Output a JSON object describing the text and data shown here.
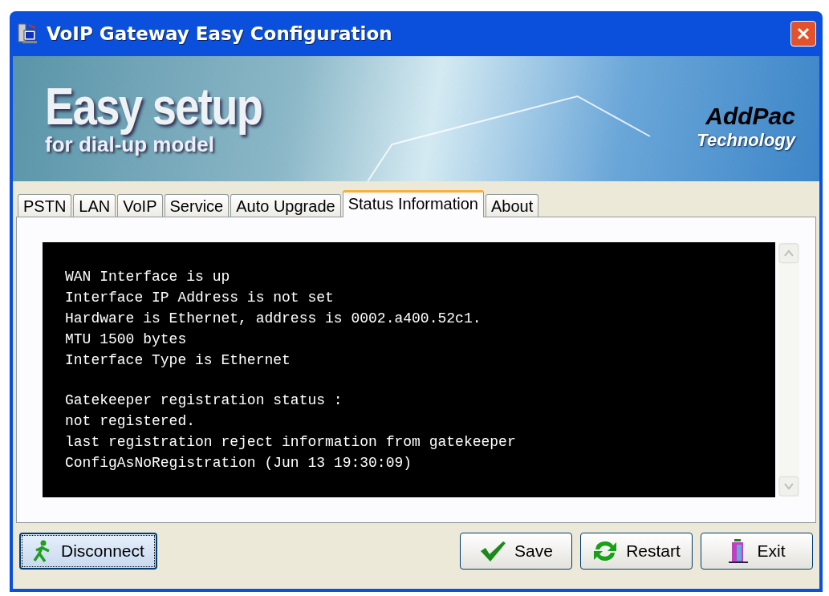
{
  "window": {
    "title": "VoIP Gateway Easy Configuration"
  },
  "banner": {
    "headline": "Easy setup",
    "subtitle": "for dial-up model",
    "brand": "AddPac",
    "brand_sub": "Technology"
  },
  "tabs": [
    {
      "label": "PSTN",
      "selected": false
    },
    {
      "label": "LAN",
      "selected": false
    },
    {
      "label": "VoIP",
      "selected": false
    },
    {
      "label": "Service",
      "selected": false
    },
    {
      "label": "Auto Upgrade",
      "selected": false
    },
    {
      "label": "Status Information",
      "selected": true
    },
    {
      "label": "About",
      "selected": false
    }
  ],
  "console": {
    "blocks": [
      [
        "WAN Interface is up",
        "Interface IP Address is not set",
        "Hardware is Ethernet, address is 0002.a400.52c1.",
        "MTU 1500 bytes",
        "Interface Type is Ethernet"
      ],
      [
        "Gatekeeper registration status :",
        "not registered.",
        "last registration reject information from gatekeeper",
        "ConfigAsNoRegistration (Jun 13 19:30:09)"
      ]
    ]
  },
  "buttons": [
    {
      "kind": "disconnect",
      "label": "Disconnect",
      "focused": true
    },
    {
      "kind": "save",
      "label": "Save",
      "focused": false
    },
    {
      "kind": "restart",
      "label": "Restart",
      "focused": false
    },
    {
      "kind": "exit",
      "label": "Exit",
      "focused": false
    }
  ]
}
